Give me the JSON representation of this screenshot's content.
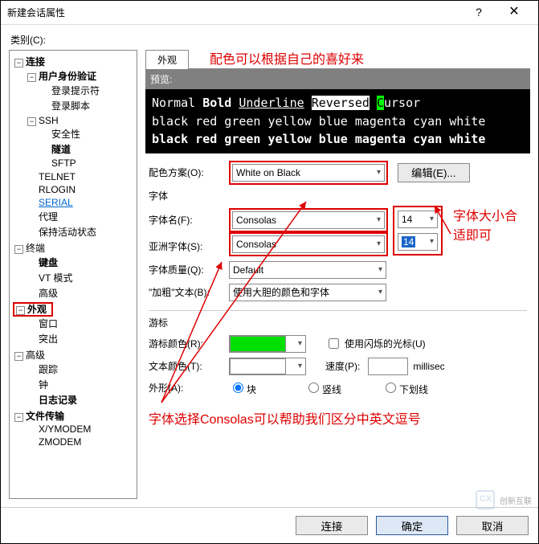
{
  "title": "新建会话属性",
  "category_label": "类别(C):",
  "tree": {
    "n0": "连接",
    "n1": "用户身份验证",
    "n1a": "登录提示符",
    "n1b": "登录脚本",
    "n2": "SSH",
    "n2a": "安全性",
    "n2b": "隧道",
    "n2c": "SFTP",
    "n3": "TELNET",
    "n4": "RLOGIN",
    "n5": "SERIAL",
    "n6": "代理",
    "n7": "保持活动状态",
    "n8": "终端",
    "n8a": "键盘",
    "n8b": "VT 模式",
    "n8c": "高级",
    "n9": "外观",
    "n9a": "窗口",
    "n9b": "突出",
    "n10": "高级",
    "n10a": "跟踪",
    "n10b": "钟",
    "n10c": "日志记录",
    "n11": "文件传输",
    "n11a": "X/YMODEM",
    "n11b": "ZMODEM"
  },
  "tab": "外观",
  "anno_top": "配色可以根据自己的喜好来",
  "preview_label": "预览:",
  "preview": {
    "normal": "Normal",
    "bold": "Bold",
    "underline": "Underline",
    "reversed": "Reversed",
    "cursor_c": "C",
    "cursor_rest": "ursor",
    "row2": "black red green yellow blue magenta cyan white",
    "row3": "black red green yellow blue magenta cyan white"
  },
  "scheme_label": "配色方案(O):",
  "scheme_value": "White on Black",
  "edit_btn": "编辑(E)...",
  "font_group": "字体",
  "font_name_label": "字体名(F):",
  "font_name_value": "Consolas",
  "font_size1": "14",
  "asian_font_label": "亚洲字体(S):",
  "asian_font_value": "Consolas",
  "font_size2": "14",
  "quality_label": "字体质量(Q):",
  "quality_value": "Default",
  "bold_text_label": "\"加粗\"文本(B):",
  "bold_text_value": "使用大胆的颜色和字体",
  "anno_right1": "字体大小合",
  "anno_right2": "适即可",
  "cursor_group": "游标",
  "cursor_color_label": "游标颜色(R):",
  "blink_label": "使用闪烁的光标(U)",
  "text_color_label": "文本颜色(T):",
  "speed_label": "速度(P):",
  "speed_unit": "millisec",
  "shape_label": "外形(A):",
  "shape_block": "块",
  "shape_vline": "竖线",
  "shape_uline": "下划线",
  "anno_bottom": "字体选择Consolas可以帮助我们区分中英文逗号",
  "btn_connect": "连接",
  "btn_ok": "确定",
  "btn_cancel": "取消",
  "watermark": "创新互联"
}
